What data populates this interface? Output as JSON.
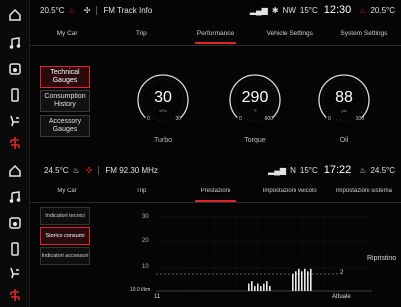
{
  "top": {
    "status": {
      "temp_left": "20.5°C",
      "radio": "FM Track Info",
      "compass": "NW",
      "outside_temp": "15°C",
      "clock": "12:30",
      "temp_right": "20.5°C"
    },
    "tabs": [
      "My Car",
      "Trip",
      "Performance",
      "Vehicle Settings",
      "System Settings"
    ],
    "active_tab": 2,
    "side_buttons": [
      "Technical Gauges",
      "Consumption History",
      "Accessory Gauges"
    ],
    "gauges": [
      {
        "value": "30",
        "unit": "kPa",
        "min": "0",
        "max": "30",
        "label": "Turbo",
        "fill": 0.0
      },
      {
        "value": "290",
        "unit": "°F",
        "min": "0",
        "max": "600",
        "label": "Torque",
        "fill": 0.48
      },
      {
        "value": "88",
        "unit": "psi",
        "min": "0",
        "max": "100",
        "label": "Oil",
        "fill": 0.88
      }
    ]
  },
  "bottom": {
    "status": {
      "temp_left": "24.5°C",
      "radio": "FM 92.30 MHz",
      "compass": "N",
      "outside_temp": "15°C",
      "clock": "17:22",
      "temp_right": "24.5°C"
    },
    "tabs": [
      "My Car",
      "Trip",
      "Prestazioni",
      "Impostazioni veicolo",
      "Impostazioni sistema"
    ],
    "active_tab": 2,
    "side_buttons": [
      "Indicatori tecnici",
      "Storico consumi",
      "Indicatori accessori"
    ],
    "chart_data": {
      "type": "bar",
      "y_ticks": [
        "30",
        "20",
        "10"
      ],
      "x_start_label": "10.0 l/km",
      "x_left_label": "11",
      "x_right_label": "Attuale",
      "reference_value": "2",
      "side_label": "Ripristino",
      "values": [
        3,
        4,
        2,
        3,
        2,
        3,
        4,
        2,
        7,
        8,
        9,
        8,
        9,
        8,
        9
      ]
    }
  }
}
